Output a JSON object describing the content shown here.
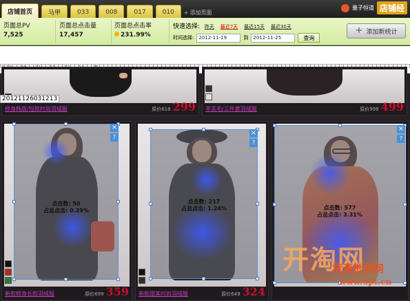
{
  "tabs": [
    {
      "label": "店铺首页",
      "active": true
    },
    {
      "label": "马甲",
      "active": false
    },
    {
      "label": "033",
      "active": false
    },
    {
      "label": "008",
      "active": false
    },
    {
      "label": "017",
      "active": false
    },
    {
      "label": "010",
      "active": false
    }
  ],
  "add_page_label": "添加页面",
  "brand": {
    "name": "量子恒道",
    "sub": "",
    "tag": "店铺经"
  },
  "stats": {
    "pv_label": "页面总PV",
    "pv_value": "7,525",
    "clicks_label": "页面总点击量",
    "clicks_value": "17,457",
    "rate_label": "页面总点击率",
    "rate_value": "231.99%"
  },
  "quick_select": {
    "label": "快速选择:",
    "options": [
      {
        "label": "昨天",
        "active": false
      },
      {
        "label": "最近7天",
        "active": true
      },
      {
        "label": "最近15天",
        "active": false
      },
      {
        "label": "最近30天",
        "active": false
      }
    ]
  },
  "range": {
    "label": "时间选择:",
    "from": "2012-11-19",
    "to_label": "到",
    "to": "2012-11-25",
    "query_label": "查询"
  },
  "add_stats_button": "添加新统计",
  "ruler_labels": [
    "1.19",
    "20",
    "21",
    "22",
    "23",
    "24",
    "25"
  ],
  "id_label": "20121126031213",
  "top_row": [
    {
      "name": "修身韩版/短款时尚羽绒服",
      "price_label": "原价618",
      "price": "299"
    },
    {
      "name": "羊羔毛/三件套羽绒服",
      "price_label": "原价998",
      "price": "499"
    }
  ],
  "bottom_row": [
    {
      "name": "新款修身长款羽绒服",
      "price_label": "原价699",
      "price": "359",
      "clicks": "点击数: 50",
      "rate": "占总点击: 0.29%"
    },
    {
      "name": "新款甜美时尚羽绒服",
      "price_label": "原价649",
      "price": "324",
      "clicks": "点击数: 217",
      "rate": "占总点击: 1.24%"
    },
    {
      "name": "",
      "price_label": "",
      "price": "",
      "clicks": "点击数: 577",
      "rate": "占总点击: 3.31%"
    }
  ],
  "watermark": {
    "big": "开淘网",
    "line1": "货源批发网",
    "line2": "www.6pt.cn"
  },
  "colors": {
    "accent_red": "#d10000",
    "price_red": "#c8102e",
    "link_purple": "#c43dbb",
    "heat_blue": "#4a90d9"
  }
}
